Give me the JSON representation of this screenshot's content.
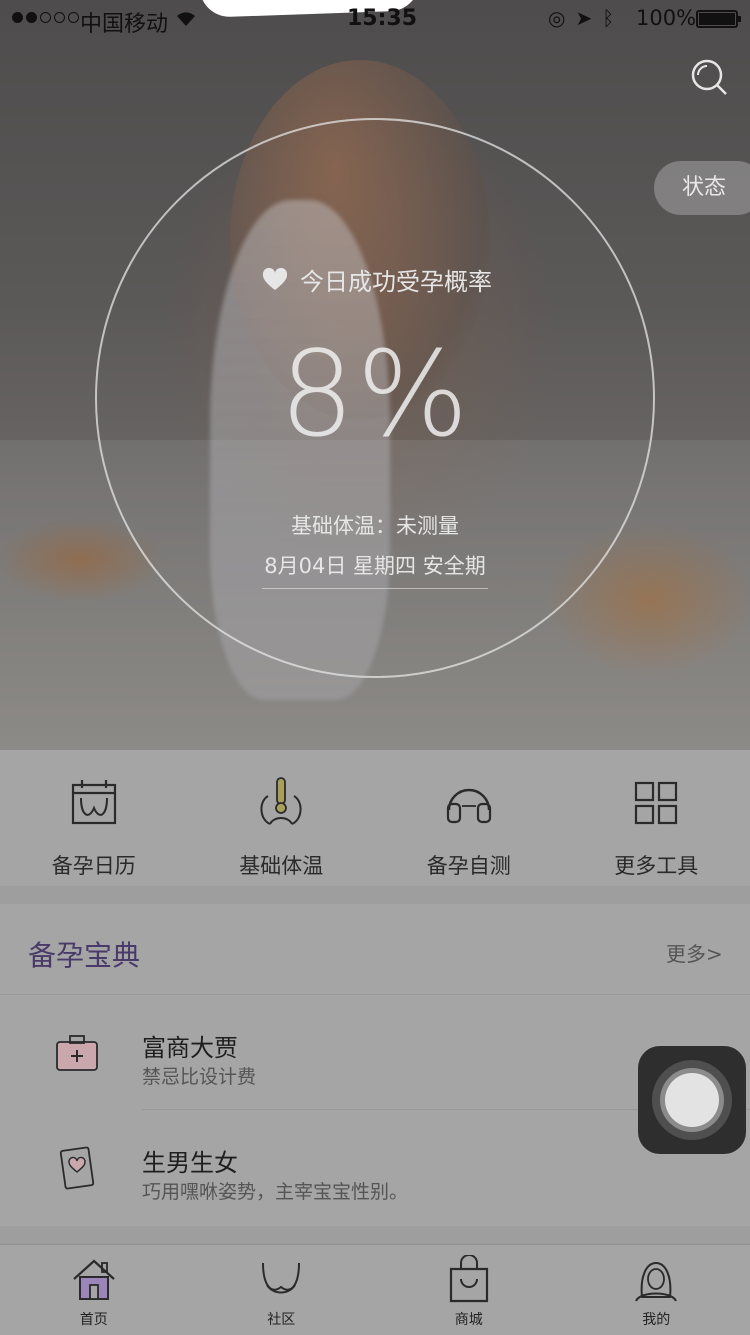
{
  "status_bar": {
    "carrier": "中国移动",
    "time": "15:35",
    "battery_percent": "100%",
    "battery_level": 1.0,
    "signal_bars_filled": 2,
    "signal_bars_total": 5
  },
  "hero": {
    "state_button": "状态",
    "probability_label": "今日成功受孕概率",
    "probability_value": "8%",
    "basal_temp": "基础体温：未测量",
    "date_info": "8月04日 星期四 安全期"
  },
  "tools": [
    {
      "label": "备孕日历",
      "icon": "calendar-icon"
    },
    {
      "label": "基础体温",
      "icon": "thermometer-icon"
    },
    {
      "label": "备孕自测",
      "icon": "headphones-icon"
    },
    {
      "label": "更多工具",
      "icon": "grid-icon"
    }
  ],
  "section": {
    "title": "备孕宝典",
    "more": "更多>",
    "items": [
      {
        "title": "富商大贾",
        "subtitle": "禁忌比设计费",
        "icon": "medical-kit-icon"
      },
      {
        "title": "生男生女",
        "subtitle": "巧用嘿咻姿势，主宰宝宝性别。",
        "icon": "heart-card-icon"
      }
    ]
  },
  "tabbar": [
    {
      "label": "首页",
      "icon": "home-icon"
    },
    {
      "label": "社区",
      "icon": "community-icon"
    },
    {
      "label": "商城",
      "icon": "shopping-bag-icon"
    },
    {
      "label": "我的",
      "icon": "profile-icon"
    }
  ],
  "colors": {
    "accent": "#4a3a6a",
    "overlay": "#a5a5a5"
  }
}
